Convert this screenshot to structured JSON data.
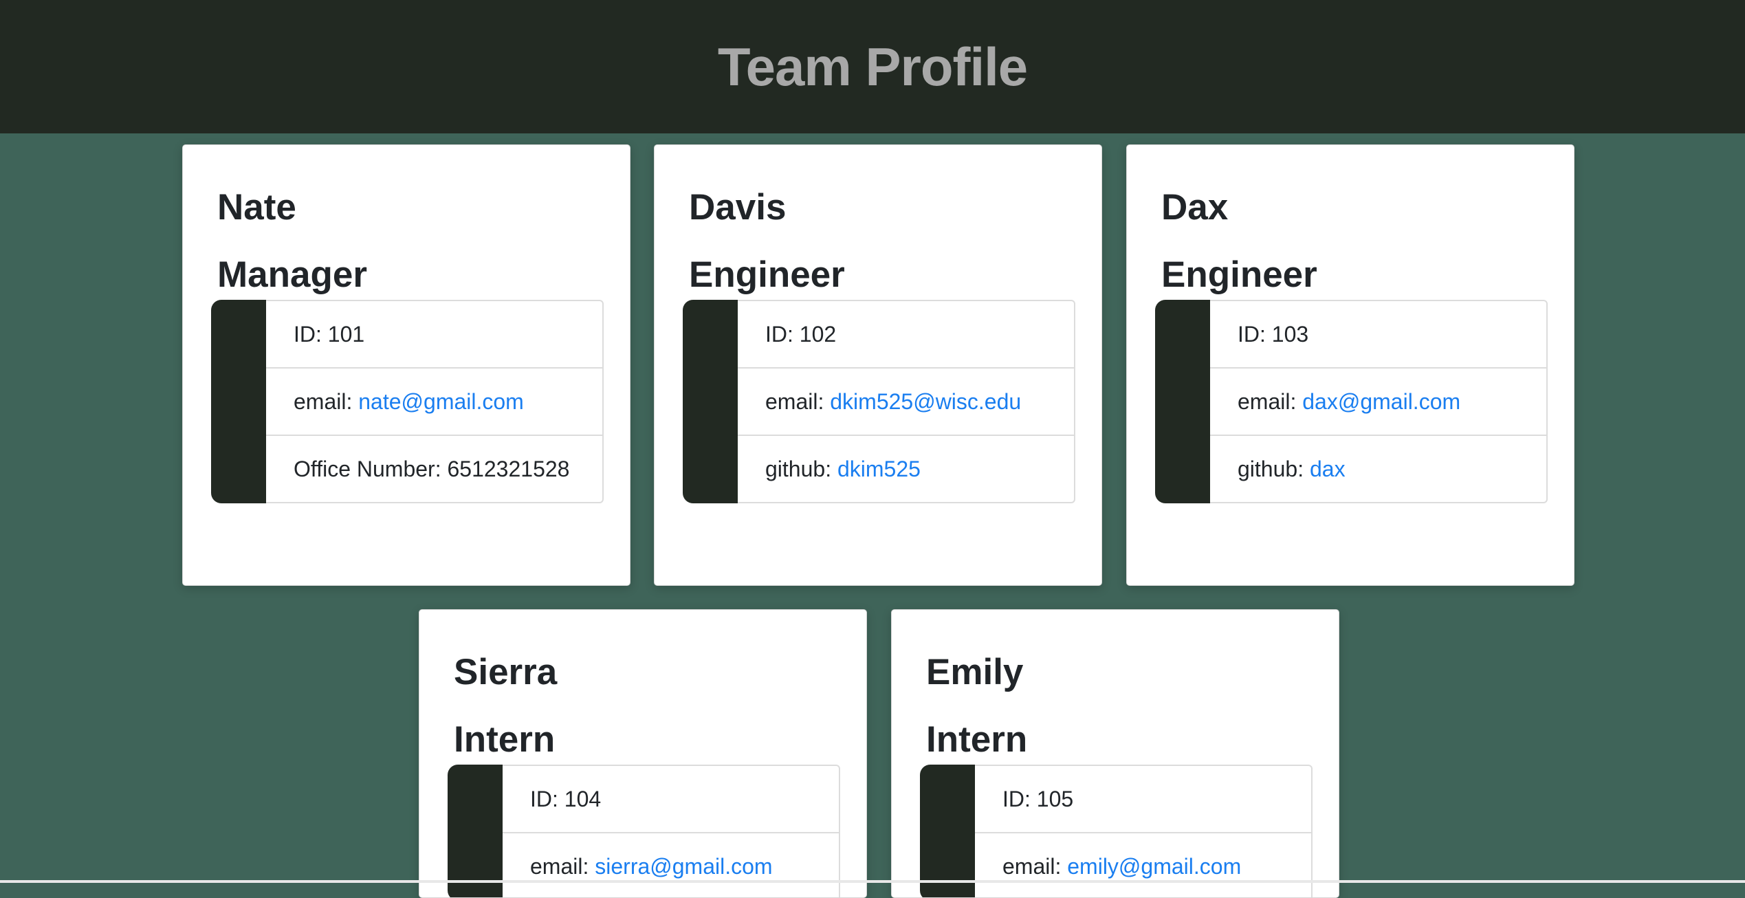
{
  "header": {
    "title": "Team Profile"
  },
  "members": [
    {
      "name": "Nate",
      "role": "Manager",
      "id_label": "ID: ",
      "id": "101",
      "email_label": "email: ",
      "email": "nate@gmail.com",
      "extra_label": "Office Number: ",
      "extra": "6512321528",
      "extra_is_link": false
    },
    {
      "name": "Davis",
      "role": "Engineer",
      "id_label": "ID: ",
      "id": "102",
      "email_label": "email: ",
      "email": "dkim525@wisc.edu",
      "extra_label": "github: ",
      "extra": "dkim525",
      "extra_is_link": true
    },
    {
      "name": "Dax",
      "role": "Engineer",
      "id_label": "ID: ",
      "id": "103",
      "email_label": "email: ",
      "email": "dax@gmail.com",
      "extra_label": "github: ",
      "extra": "dax",
      "extra_is_link": true
    },
    {
      "name": "Sierra",
      "role": "Intern",
      "id_label": "ID: ",
      "id": "104",
      "email_label": "email: ",
      "email": "sierra@gmail.com"
    },
    {
      "name": "Emily",
      "role": "Intern",
      "id_label": "ID: ",
      "id": "105",
      "email_label": "email: ",
      "email": "emily@gmail.com"
    }
  ],
  "colors": {
    "background": "#3f6459",
    "header": "#222922",
    "title": "#a8a8a8",
    "link": "#1a7ef0"
  }
}
